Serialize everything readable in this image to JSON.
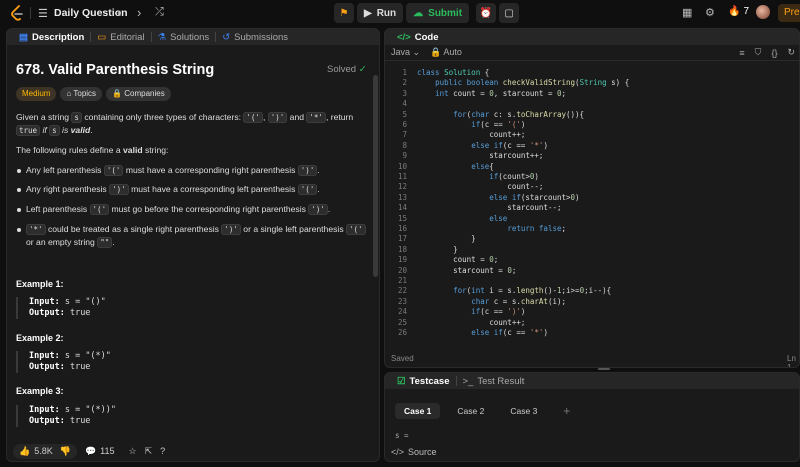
{
  "topbar": {
    "title": "Daily Question",
    "run": "Run",
    "submit": "Submit",
    "streak": "7",
    "premium": "Pre"
  },
  "left_tabs": [
    "Description",
    "Editorial",
    "Solutions",
    "Submissions"
  ],
  "problem": {
    "title": "678. Valid Parenthesis String",
    "status": "Solved",
    "difficulty": "Medium",
    "tags": [
      "Topics",
      "Companies"
    ],
    "intro_1": "Given a string",
    "intro_var": "s",
    "intro_2": "containing only three types of characters:",
    "c1": "'('",
    "c2": "')'",
    "intro_and": "and",
    "c3": "'*'",
    "intro_3": ", return",
    "ret": "true",
    "intro_if": "if",
    "intro_s2": "s",
    "intro_is": "is",
    "intro_valid": "valid",
    "rules_intro_1": "The following rules define a",
    "rules_valid": "valid",
    "rules_intro_2": "string:",
    "rules": [
      {
        "a": "Any left parenthesis",
        "code": "'('",
        "b": "must have a corresponding right parenthesis",
        "code2": "')'",
        "c": "."
      },
      {
        "a": "Any right parenthesis",
        "code": "')'",
        "b": "must have a corresponding left parenthesis",
        "code2": "'('",
        "c": "."
      },
      {
        "a": "Left parenthesis",
        "code": "'('",
        "b": "must go before the corresponding right parenthesis",
        "code2": "')'",
        "c": "."
      },
      {
        "a": "",
        "code": "'*'",
        "b": "could be treated as a single right parenthesis",
        "code2": "')'",
        "c": "or a single left parenthesis",
        "code3": "'('",
        "d": "or",
        "e": "an empty string",
        "code4": "\"\"",
        "f": "."
      }
    ],
    "examples": [
      {
        "title": "Example 1:",
        "input_label": "Input:",
        "input": "s = \"()\"",
        "output_label": "Output:",
        "output": "true"
      },
      {
        "title": "Example 2:",
        "input_label": "Input:",
        "input": "s = \"(*)\"",
        "output_label": "Output:",
        "output": "true"
      },
      {
        "title": "Example 3:",
        "input_label": "Input:",
        "input": "s = \"(*))\"",
        "output_label": "Output:",
        "output": "true"
      }
    ]
  },
  "bottom": {
    "likes": "5.8K",
    "comments": "115"
  },
  "code_panel": {
    "title": "Code",
    "language": "Java",
    "auto": "Auto",
    "status": "Saved",
    "position": "Ln 1"
  },
  "code_lines": [
    "class Solution {",
    "    public boolean checkValidString(String s) {",
    "    int count = 0, starcount = 0;",
    "",
    "        for(char c: s.toCharArray()){",
    "            if(c == '(')",
    "                count++;",
    "            else if(c == '*')",
    "                starcount++;",
    "            else{",
    "                if(count>0)",
    "                    count--;",
    "                else if(starcount>0)",
    "                    starcount--;",
    "                else",
    "                    return false;",
    "            }",
    "        }",
    "        count = 0;",
    "        starcount = 0;",
    "",
    "        for(int i = s.length()-1;i>=0;i--){",
    "            char c = s.charAt(i);",
    "            if(c == ')')",
    "                count++;",
    "            else if(c == '*')"
  ],
  "test_panel": {
    "tab1": "Testcase",
    "tab2": "Test Result",
    "cases": [
      "Case 1",
      "Case 2",
      "Case 3"
    ],
    "add": "+",
    "s_label": "s =",
    "source": "Source"
  },
  "colors": {
    "accent_green": "#2cbb5d",
    "medium": "#ffb800",
    "premium": "#ffa116"
  }
}
